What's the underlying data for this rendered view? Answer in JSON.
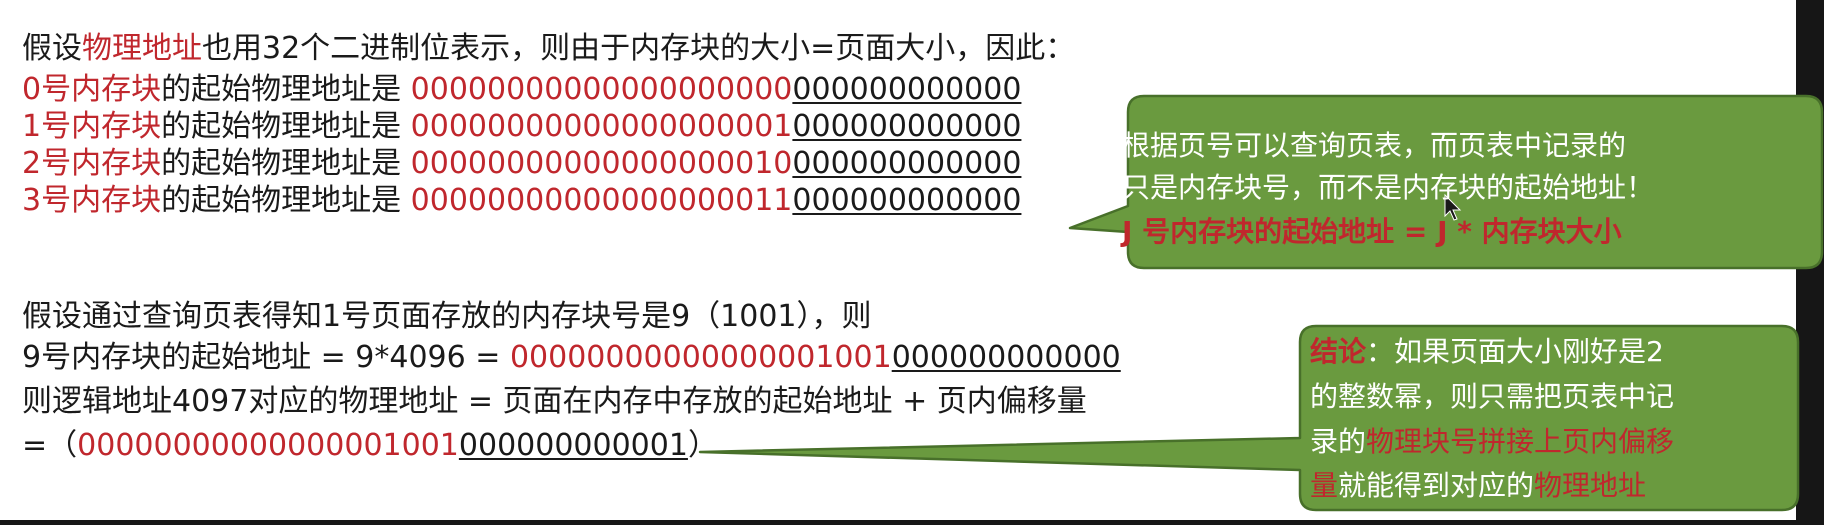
{
  "intro": {
    "pre": "假设",
    "highlight": "物理地址",
    "post": "也用32个二进制位表示，则由于内存块的大小=页面大小，因此："
  },
  "blocks": [
    {
      "label": "0号内存块",
      "mid": "的起始物理地址是 ",
      "high_bits": "00000000000000000000",
      "low_bits": "000000000000"
    },
    {
      "label": "1号内存块",
      "mid": "的起始物理地址是 ",
      "high_bits": "00000000000000000001",
      "low_bits": "000000000000"
    },
    {
      "label": "2号内存块",
      "mid": "的起始物理地址是 ",
      "high_bits": "00000000000000000010",
      "low_bits": "000000000000"
    },
    {
      "label": "3号内存块",
      "mid": "的起始物理地址是 ",
      "high_bits": "00000000000000000011",
      "low_bits": "000000000000"
    }
  ],
  "example": {
    "line1": "假设通过查询页表得知1号页面存放的内存块号是9（1001），则",
    "line2_prefix": "9号内存块的起始地址 = 9*4096 = ",
    "line2_high": "00000000000000001001",
    "line2_low": "000000000000",
    "line3": "则逻辑地址4097对应的物理地址 = 页面在内存中存放的起始地址 + 页内偏移量",
    "line4_prefix": "=（",
    "line4_high": "00000000000000001001",
    "line4_low": "000000000001",
    "line4_suffix": "）"
  },
  "callout_top": {
    "line1": "根据页号可以查询页表，而页表中记录的",
    "line2": "只是内存块号，而不是内存块的起始地址！",
    "line3": "J 号内存块的起始地址 = J * 内存块大小"
  },
  "callout_bottom": {
    "label": "结论",
    "line1_rest": "：如果页面大小刚好是2",
    "line2": "的整数幂，则只需把页表中记",
    "line3_pre": "录的",
    "line3_hl": "物理块号拼接上页内偏移",
    "line4_hl1": "量",
    "line4_mid": "就能得到对应的",
    "line4_hl2": "物理地址"
  },
  "colors": {
    "highlight_red": "#c0272d",
    "callout_fill": "#6a9a3f",
    "callout_border": "#48702a",
    "text": "#1a1a1a"
  },
  "icons": [
    "mouse-cursor-icon"
  ]
}
